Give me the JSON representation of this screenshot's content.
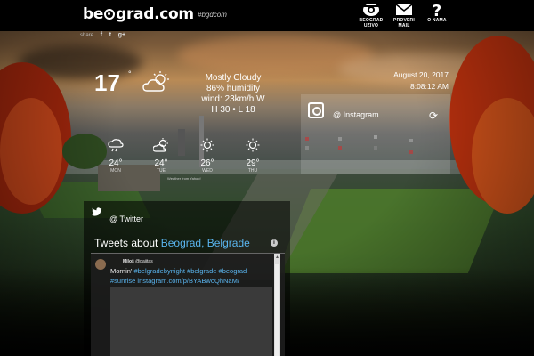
{
  "header": {
    "logo_pre": "be",
    "logo_post": "grad.com",
    "hashtag": "#bgdcom",
    "nav": [
      {
        "icon": "webcam-icon",
        "label": "BEOGRAD UZIVO"
      },
      {
        "icon": "mail-icon",
        "label": "PROVERI MAIL"
      },
      {
        "icon": "question-icon",
        "label": "O NAMA"
      }
    ]
  },
  "share": {
    "label": "share",
    "items": [
      "f",
      "t",
      "g+"
    ]
  },
  "weather": {
    "temp": "17",
    "deg": "°",
    "desc": "Mostly Cloudy",
    "humidity": "86% humidity",
    "wind": "wind: 23km/h W",
    "hilo": "H 30 • L 18",
    "forecast": [
      {
        "temp": "24°",
        "day": "MON",
        "icon": "rain-icon"
      },
      {
        "temp": "24°",
        "day": "TUE",
        "icon": "partly-sunny-icon"
      },
      {
        "temp": "26°",
        "day": "WED",
        "icon": "sunny-icon"
      },
      {
        "temp": "29°",
        "day": "THU",
        "icon": "sunny-icon"
      }
    ],
    "credit": "Weather from Yahoo!"
  },
  "datetime": {
    "date": "August 20, 2017",
    "time": "8:08:12 AM"
  },
  "instagram": {
    "title": "@ Instagram"
  },
  "twitter": {
    "title": "@ Twitter",
    "caption_prefix": "Tweets about ",
    "caption_link": "Beograd, Belgrade",
    "tweet": {
      "user": "Miloš",
      "handle": "@pajitas",
      "text_lead": "Mornin' ",
      "text_tags1": "#belgradebynight #belgrade #beograd",
      "text_tags2": "#sunrise instagram.com/p/BYABwoQhNaM/"
    }
  },
  "colors": {
    "link": "#5ab4ee",
    "panel": "#000000",
    "autumn": "#b8300e"
  }
}
